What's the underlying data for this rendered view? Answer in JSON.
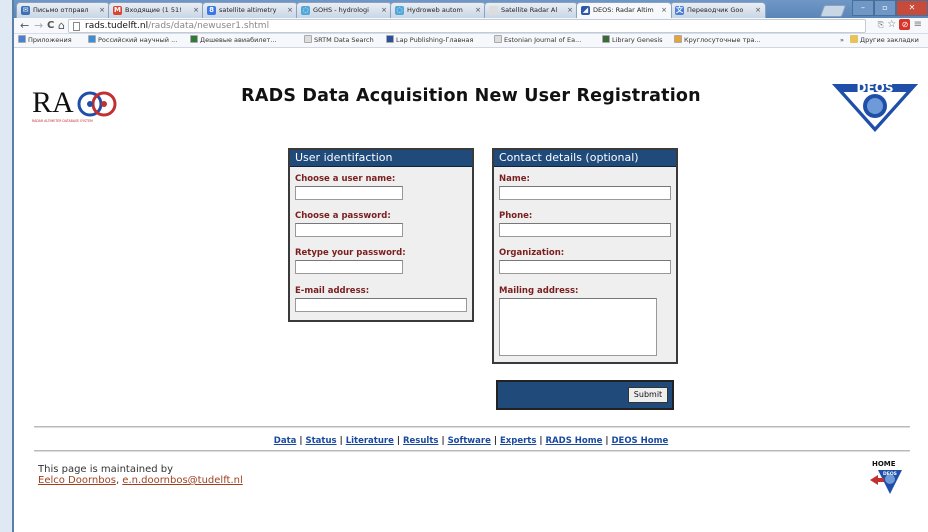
{
  "browser": {
    "tabs": [
      {
        "label": "Письмо отправл",
        "fav_color": "#3b6fb6",
        "fav_glyph": "✉"
      },
      {
        "label": "Входящие (1 51!",
        "fav_color": "#d9452f",
        "fav_glyph": "M"
      },
      {
        "label": "satellite altimetry",
        "fav_color": "#3b78e7",
        "fav_glyph": "8"
      },
      {
        "label": "GOHS - hydrologi",
        "fav_color": "#52a7d8",
        "fav_glyph": "◌"
      },
      {
        "label": "Hydroweb autom",
        "fav_color": "#52a7d8",
        "fav_glyph": "◌"
      },
      {
        "label": "Satellite Radar Al",
        "fav_color": "#dddddd",
        "fav_glyph": ""
      },
      {
        "label": "DEOS: Radar Altim",
        "fav_color": "#2c59a8",
        "fav_glyph": "◢"
      },
      {
        "label": "Переводчик Goo",
        "fav_color": "#4a80d6",
        "fav_glyph": "文"
      }
    ],
    "close_glyph": "×",
    "url_host": "rads.tudelft.nl",
    "url_path": "/rads/data/newuser1.shtml",
    "back_glyph": "←",
    "forward_glyph": "→",
    "reload_glyph": "C",
    "home_glyph": "⌂",
    "bookmarks": [
      {
        "label": "Приложения",
        "color": "#4a7fd6"
      },
      {
        "label": "Российский научный ...",
        "color": "#3a8fd6"
      },
      {
        "label": "Дешевые авиабилет...",
        "color": "#2f7a3a"
      },
      {
        "label": "SRTM Data Search",
        "color": "#dddddd"
      },
      {
        "label": "Lap Publishing-Главная",
        "color": "#2a4fa0"
      },
      {
        "label": "Estonian Journal of Ea...",
        "color": "#dddddd"
      },
      {
        "label": "Library Genesis",
        "color": "#3a6a3a"
      },
      {
        "label": "Круглосуточные тра...",
        "color": "#e8a23a"
      }
    ],
    "bookmarks_more": "»",
    "other_bookmarks": "Другие закладки"
  },
  "page": {
    "title": "RADS Data Acquisition New User Registration",
    "rads_logo_sub": "RADAR ALTIMETER DATABASE SYSTEM",
    "deos_logo": "DEOS",
    "user_box": {
      "heading": "User identifaction",
      "username_label": "Choose a user name:",
      "password_label": "Choose a password:",
      "retype_label": "Retype your password:",
      "email_label": "E-mail address:"
    },
    "contact_box": {
      "heading": "Contact details (optional)",
      "name_label": "Name:",
      "phone_label": "Phone:",
      "org_label": "Organization:",
      "mail_label": "Mailing address:"
    },
    "submit_label": "Submit",
    "footer_links": [
      "Data",
      "Status",
      "Literature",
      "Results",
      "Software",
      "Experts",
      "RADS Home",
      "DEOS Home"
    ],
    "maintained_text": "This page is maintained by",
    "maintainer_name": "Eelco Doornbos",
    "maintainer_email": "e.n.doornbos@tudelft.nl",
    "home_label": "HOME",
    "home_deos": "DEOS"
  }
}
